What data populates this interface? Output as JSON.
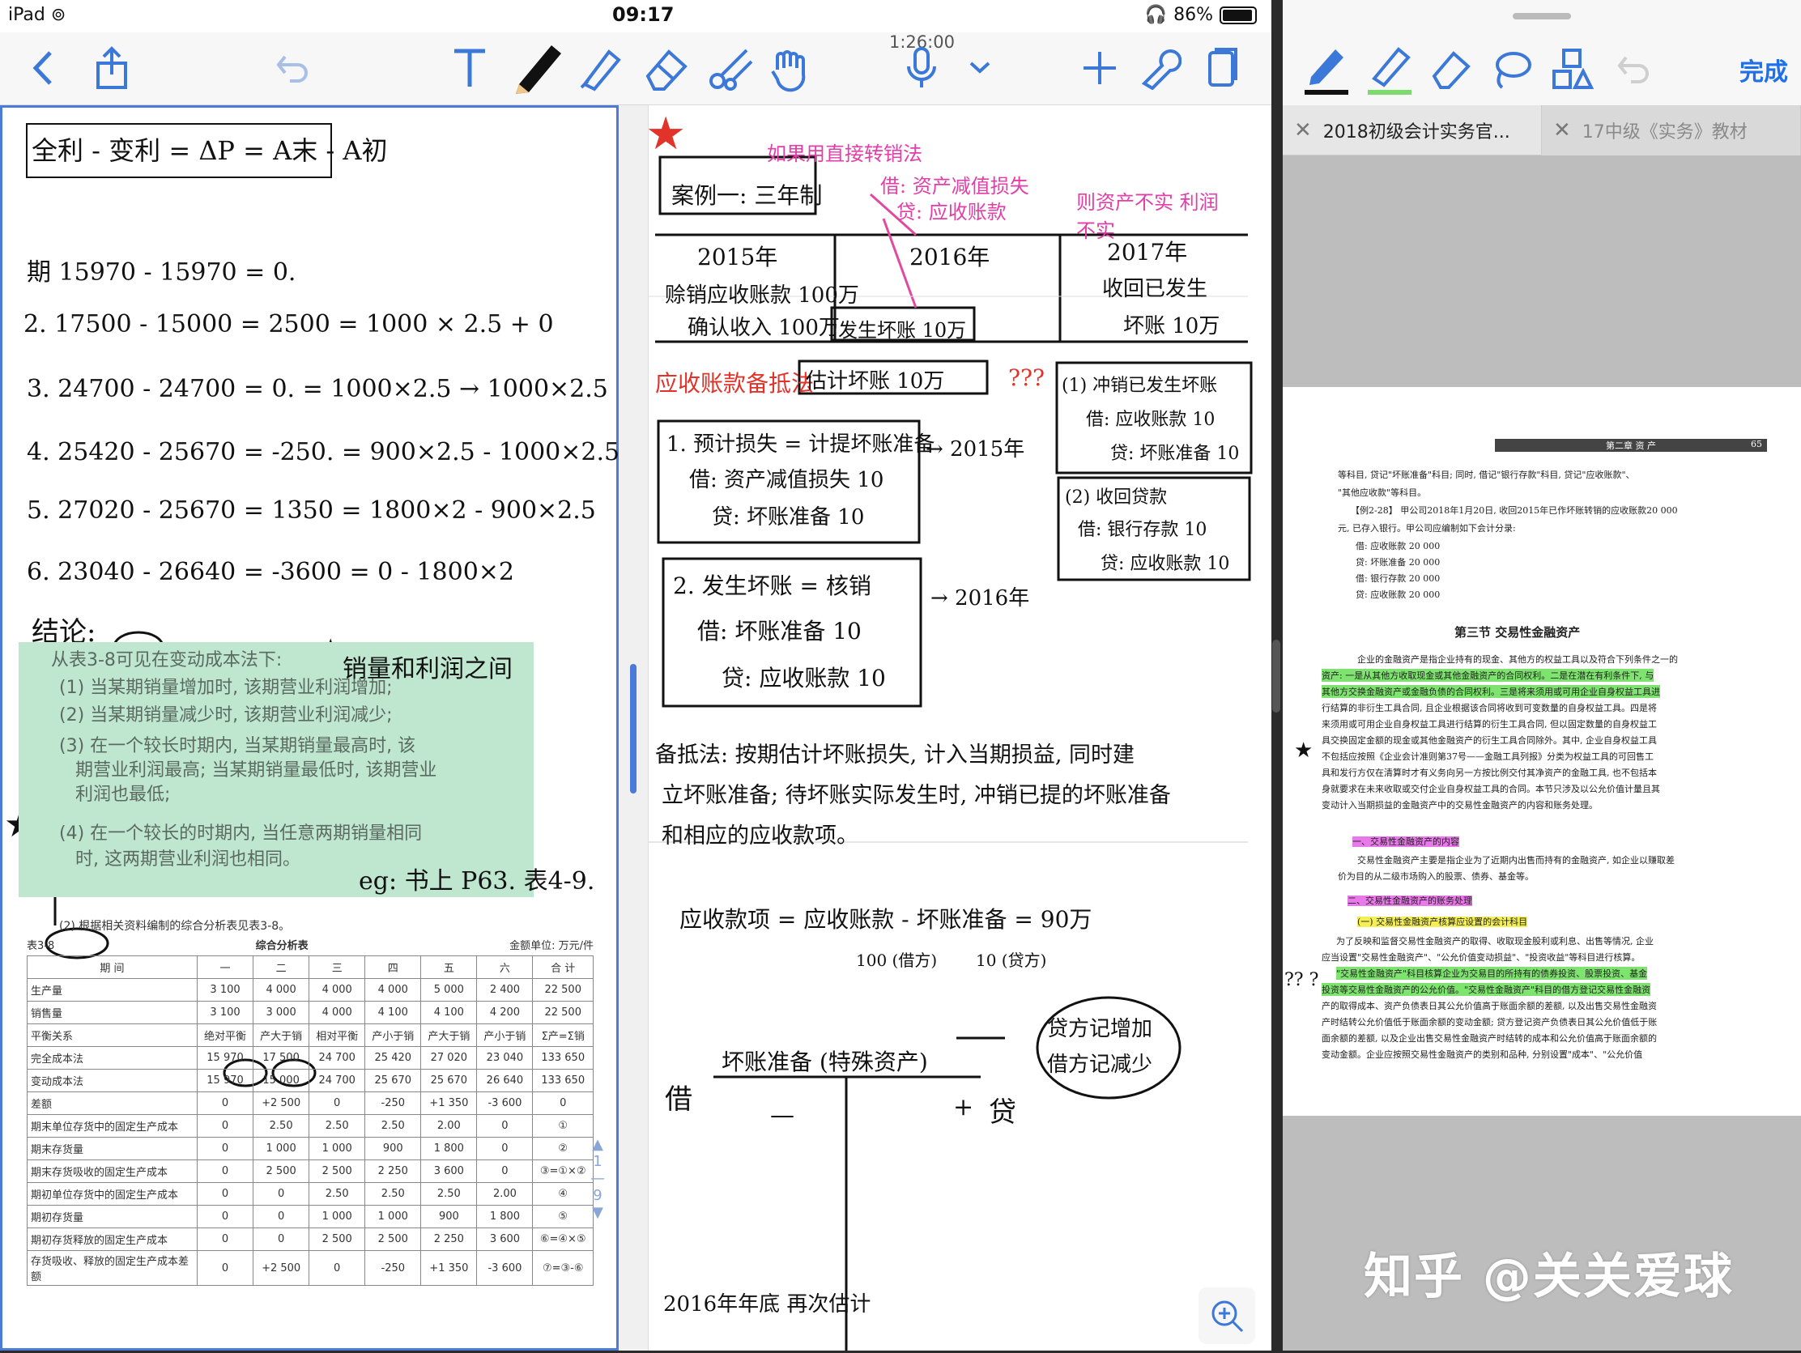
{
  "status": {
    "device": "iPad",
    "time": "09:17",
    "battery": "86%"
  },
  "notes_toolbar": {
    "timer": "1:26:00"
  },
  "left_page": {
    "formula_box": "全利 - 变利 = ΔP = A末 - A初",
    "lines": [
      "期 15970 - 15970 = 0.",
      "2.  17500 - 15000 = 2500 = 1000 × 2.5 + 0",
      "3.  24700 - 24700 = 0. = 1000×2.5 → 1000×2.5",
      "4.  25420 - 25670 = -250. = 900×2.5 - 1000×2.5",
      "5.  27020 - 25670 = 1350 = 1800×2 - 900×2.5",
      "6.  23040 - 26640 = -3600 = 0 - 1800×2",
      "结论:"
    ],
    "annotation_top": "销量和利润之间",
    "scan_lines": [
      "从表3-8可见在变动成本法下:",
      "(1) 当某期销量增加时, 该期营业利润增加;",
      "(2) 当某期销量减少时, 该期营业利润减少;",
      "(3) 在一个较长时期内, 当某期销量最高时, 该",
      "期营业利润最高; 当某期销量最低时, 该期营业",
      "利润也最低;",
      "(4) 在一个较长的时期内, 当任意两期销量相同",
      "时, 这两期营业利润也相同。"
    ],
    "annotation_bottom": "eg: 书上 P63. 表4-9.",
    "table_caption": "(2) 根据相关资料编制的综合分析表见表3-8。",
    "table_label": "表3-8",
    "table_title": "综合分析表",
    "table_unit": "金额单位: 万元/件",
    "table_headers": [
      "期 间",
      "一",
      "二",
      "三",
      "四",
      "五",
      "六",
      "合 计"
    ],
    "table_rows": [
      [
        "生产量",
        "3 100",
        "4 000",
        "4 000",
        "4 000",
        "5 000",
        "2 400",
        "22 500"
      ],
      [
        "销售量",
        "3 100",
        "3 000",
        "4 000",
        "4 100",
        "4 100",
        "4 200",
        "22 500"
      ],
      [
        "平衡关系",
        "绝对平衡",
        "产大于销",
        "相对平衡",
        "产小于销",
        "产大于销",
        "产小于销",
        "Σ产=Σ销"
      ],
      [
        "完全成本法",
        "15 970",
        "17 500",
        "24 700",
        "25 420",
        "27 020",
        "23 040",
        "133 650"
      ],
      [
        "变动成本法",
        "15 970",
        "15 000",
        "24 700",
        "25 670",
        "25 670",
        "26 640",
        "133 650"
      ],
      [
        "差额",
        "0",
        "+2 500",
        "0",
        "-250",
        "+1 350",
        "-3 600",
        "0"
      ],
      [
        "期末单位存货中的固定生产成本",
        "0",
        "2.50",
        "2.50",
        "2.50",
        "2.00",
        "0",
        "①"
      ],
      [
        "期末存货量",
        "0",
        "1 000",
        "1 000",
        "900",
        "1 800",
        "0",
        "②"
      ],
      [
        "期末存货吸收的固定生产成本",
        "0",
        "2 500",
        "2 500",
        "2 250",
        "3 600",
        "0",
        "③=①×②"
      ],
      [
        "期初单位存货中的固定生产成本",
        "0",
        "0",
        "2.50",
        "2.50",
        "2.50",
        "2.00",
        "④"
      ],
      [
        "期初存货量",
        "0",
        "0",
        "1 000",
        "1 000",
        "900",
        "1 800",
        "⑤"
      ],
      [
        "期初存货释放的固定生产成本",
        "0",
        "0",
        "2 500",
        "2 500",
        "2 250",
        "3 600",
        "⑥=④×⑤"
      ],
      [
        "存货吸收、释放的固定生产成本差额",
        "0",
        "+2 500",
        "0",
        "-250",
        "+1 350",
        "-3 600",
        "⑦=③-⑥"
      ]
    ],
    "page_indicator": {
      "current": "1",
      "total": "9"
    }
  },
  "right_page": {
    "case_box": "案例一: 三年制",
    "direct_write_off": "如果用直接转销法",
    "dw_debit": "借: 资产减值损失",
    "dw_credit": "贷: 应收账款",
    "dw_result": "则资产不实 利润不实",
    "years": [
      "2015年",
      "2016年",
      "2017年"
    ],
    "y2015": [
      "赊销应收账款 100万",
      "确认收入 100万"
    ],
    "y2016": "发生坏账 10万",
    "y2017": [
      "收回已发生",
      "坏账 10万"
    ],
    "allowance_label": "应收账款备抵法",
    "estimate_box": "估计坏账 10万",
    "qqq": "???",
    "box1": [
      "1. 预计损失 = 计提坏账准备",
      "借: 资产减值损失  10",
      "贷: 坏账准备  10"
    ],
    "to2015": "→ 2015年",
    "box2": [
      "2. 发生坏账 = 核销",
      "借: 坏账准备  10",
      "贷: 应收账款  10"
    ],
    "to2016": "→ 2016年",
    "box3": [
      "(1) 冲销已发生坏账",
      "借: 应收账款  10",
      "贷: 坏账准备  10"
    ],
    "box4": [
      "(2) 收回贷款",
      "借: 银行存款  10",
      "贷: 应收账款  10"
    ],
    "allowance_text": [
      "备抵法: 按期估计坏账损失, 计入当期损益, 同时建",
      "立坏账准备; 待坏账实际发生时, 冲销已提的坏账准备",
      "和相应的应收款项。"
    ],
    "equation": "应收款项 = 应收账款 - 坏账准备 = 90万",
    "eq_sub1": "100 (借方)",
    "eq_sub2": "10 (贷方)",
    "t_account_title": "坏账准备 (特殊资产)",
    "t_debit": "借",
    "t_credit": "贷",
    "t_minus": "—",
    "t_plus": "+",
    "t_note": [
      "贷方记增加",
      "借方记减少"
    ],
    "bottom_note": "2016年年底 再次估计"
  },
  "pdf_app": {
    "done_label": "完成",
    "tabs": [
      {
        "label": "2018初级会计实务官...",
        "active": true
      },
      {
        "label": "17中级《实务》教材",
        "active": false
      }
    ],
    "page_header": "第二章  资  产",
    "page_number": "65",
    "lines": [
      "等科目, 贷记\"坏账准备\"科目; 同时, 借记\"银行存款\"科目, 贷记\"应收账款\"、",
      "\"其他应收款\"等科目。",
      "【例2-28】 甲公司2018年1月20日, 收回2015年已作坏账转销的应收账款20 000",
      "元, 已存入银行。甲公司应编制如下会计分录:",
      "借: 应收账款                                   20 000",
      "    贷: 坏账准备                                  20 000",
      "借: 银行存款                                   20 000",
      "    贷: 应收账款                                  20 000"
    ],
    "section_title": "第三节    交易性金融资产",
    "body_lines": [
      "企业的金融资产是指企业持有的现金、其他方的权益工具以及符合下列条件之一的",
      "资产: 一是从其他方收取现金或其他金融资产的合同权利。二是在潜在有利条件下, 与",
      "其他方交换金融资产或金融负债的合同权利。三是将来须用或可用企业自身权益工具进",
      "行结算的非衍生工具合同, 且企业根据该合同将收到可变数量的自身权益工具。四是将",
      "来须用或可用企业自身权益工具进行结算的衍生工具合同, 但以固定数量的自身权益工",
      "具交换固定金额的现金或其他金融资产的衍生工具合同除外。其中, 企业自身权益工具",
      "不包括应按照《企业会计准则第37号——金融工具列报》分类为权益工具的可回售工",
      "具和发行方仅在清算时才有义务向另一方按比例交付其净资产的金融工具, 也不包括本",
      "身就要求在未来收取或交付企业自身权益工具的合同。本节只涉及以公允价值计量且其",
      "变动计入当期损益的金融资产中的交易性金融资产的内容和账务处理。"
    ],
    "sub1": "一、交易性金融资产的内容",
    "sub1_lines": [
      "交易性金融资产主要是指企业为了近期内出售而持有的金融资产, 如企业以赚取差",
      "价为目的从二级市场购入的股票、债券、基金等。"
    ],
    "sub2": "二、交易性金融资产的账务处理",
    "sub3": "(一) 交易性金融资产核算应设置的会计科目",
    "sub3_lines": [
      "为了反映和监督交易性金融资产的取得、收取现金股利或利息、出售等情况, 企业",
      "应当设置\"交易性金融资产\"、\"公允价值变动损益\"、\"投资收益\"等科目进行核算。",
      "\"交易性金融资产\"科目核算企业为交易目的所持有的债券投资、股票投资、基金",
      "投资等交易性金融资产的公允价值。\"交易性金融资产\"科目的借方登记交易性金融资",
      "产的取得成本、资产负债表日其公允价值高于账面余额的差额, 以及出售交易性金融资",
      "产时结转公允价值低于账面余额的变动金额; 贷方登记资产负债表日其公允价值低于账",
      "面余额的差额, 以及企业出售交易性金融资产时结转的成本和公允价值高于账面余额的",
      "变动金额。企业应按照交易性金融资产的类别和品种, 分别设置\"成本\"、\"公允价值"
    ],
    "margin_qq": "??  ?",
    "watermark": "知乎 @关关爱球"
  }
}
